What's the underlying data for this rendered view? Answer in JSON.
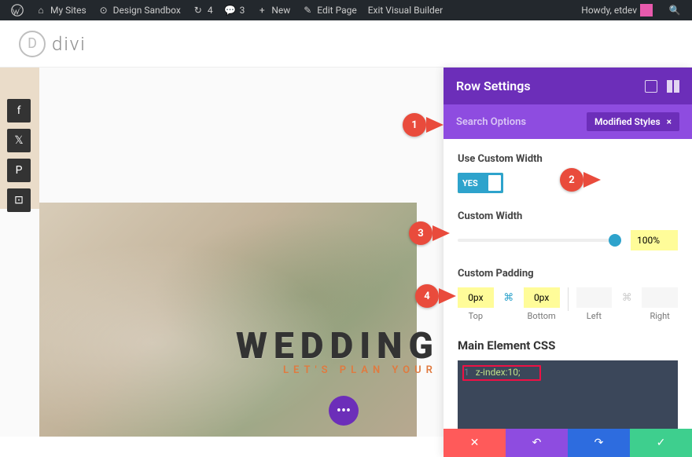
{
  "admin_bar": {
    "my_sites": "My Sites",
    "site_name": "Design Sandbox",
    "updates": "4",
    "comments": "3",
    "new": "New",
    "edit_page": "Edit Page",
    "exit_builder": "Exit Visual Builder",
    "howdy": "Howdy, etdev"
  },
  "logo_text": "divi",
  "hero": {
    "title": "WEDDING",
    "subtitle": "LET'S PLAN YOUR"
  },
  "panel": {
    "title": "Row Settings",
    "search_label": "Search Options",
    "modified_label": "Modified Styles",
    "use_custom_width_label": "Use Custom Width",
    "toggle_text": "YES",
    "custom_width_label": "Custom Width",
    "width_value": "100%",
    "custom_padding_label": "Custom Padding",
    "padding": {
      "top": {
        "value": "0px",
        "label": "Top"
      },
      "bottom": {
        "value": "0px",
        "label": "Bottom"
      },
      "left": {
        "value": "",
        "label": "Left"
      },
      "right": {
        "value": "",
        "label": "Right"
      }
    },
    "main_css_label": "Main Element CSS",
    "css_line_num": "1",
    "css_code": "z-index:10;"
  },
  "annotations": {
    "a1": "1",
    "a2": "2",
    "a3": "3",
    "a4": "4"
  }
}
